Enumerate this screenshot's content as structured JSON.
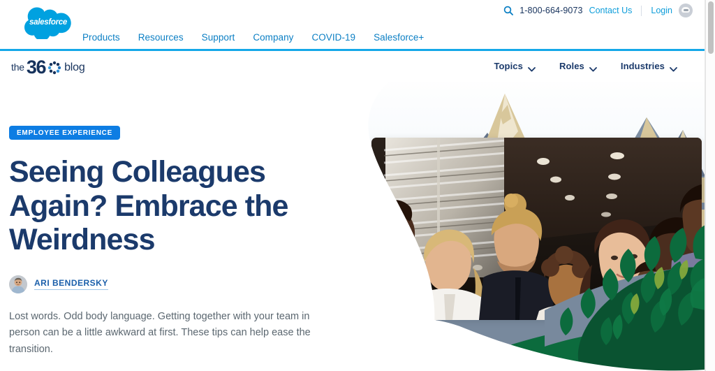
{
  "utility": {
    "search_icon": "search-icon",
    "phone": "1-800-664-9073",
    "contact_label": "Contact Us",
    "login_label": "Login",
    "avatar_icon": "user-avatar-icon"
  },
  "brand": {
    "logo_icon": "salesforce-cloud-logo",
    "logo_text": "salesforce",
    "accent_blue": "#14a8e8",
    "link_blue": "#0b7fc4"
  },
  "main_nav": {
    "items": [
      {
        "label": "Products"
      },
      {
        "label": "Resources"
      },
      {
        "label": "Support"
      },
      {
        "label": "Company"
      },
      {
        "label": "COVID-19"
      },
      {
        "label": "Salesforce+"
      }
    ]
  },
  "blog_bar": {
    "logo_the": "the",
    "logo_36": "36",
    "logo_dots_icon": "360-dots-icon",
    "logo_blog": "blog",
    "nav": [
      {
        "label": "Topics",
        "icon": "chevron-down-icon"
      },
      {
        "label": "Roles",
        "icon": "chevron-down-icon"
      },
      {
        "label": "Industries",
        "icon": "chevron-down-icon"
      }
    ]
  },
  "article": {
    "category_badge": "EMPLOYEE EXPERIENCE",
    "badge_color": "#0d7de3",
    "headline": "Seeing Colleagues Again? Embrace the Weirdness",
    "headline_color": "#1b3a6b",
    "author": {
      "name": "ARI BENDERSKY",
      "avatar_icon": "author-avatar"
    },
    "dek": "Lost words. Odd body language. Getting together with your team in person can be a little awkward at first. These tips can help ease the transition."
  },
  "hero": {
    "photo_alt": "Group of colleagues standing together in an elevator lobby",
    "decoration": {
      "mountain_icon": "mountain-illustration",
      "foliage_icon": "foliage-illustration",
      "sky_gradient_top": "#ffffff",
      "sky_gradient_bottom": "#dce9f2",
      "mountain_tan": "#d8c79b",
      "mountain_cream": "#efe6cf",
      "mountain_slate": "#7e8fa3",
      "foliage_green": "#0c6b3d",
      "foliage_dark": "#0a5331",
      "foliage_light": "#84a93c"
    }
  },
  "scrollbar": {
    "thumb_name": "vertical-scroll-thumb"
  }
}
